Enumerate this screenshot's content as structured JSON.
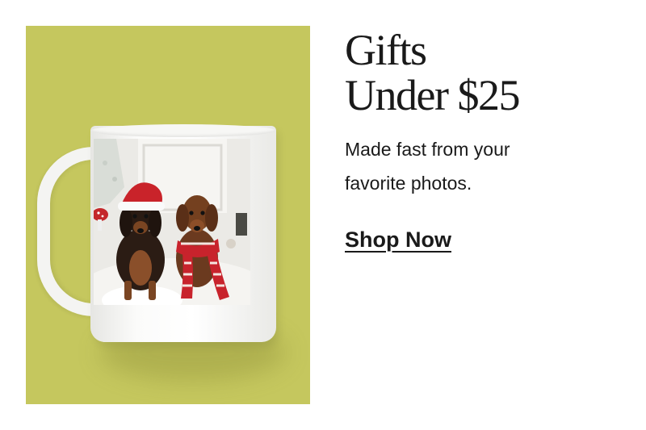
{
  "promo": {
    "title_line1": "Gifts",
    "title_line2": "Under $25",
    "description_line1": "Made fast from your",
    "description_line2": "favorite photos.",
    "cta_label": "Shop Now"
  },
  "colors": {
    "image_background": "#c5c75e",
    "text": "#1a1a1a"
  },
  "image": {
    "subject": "white photo mug with two dachshunds in holiday outfits"
  }
}
